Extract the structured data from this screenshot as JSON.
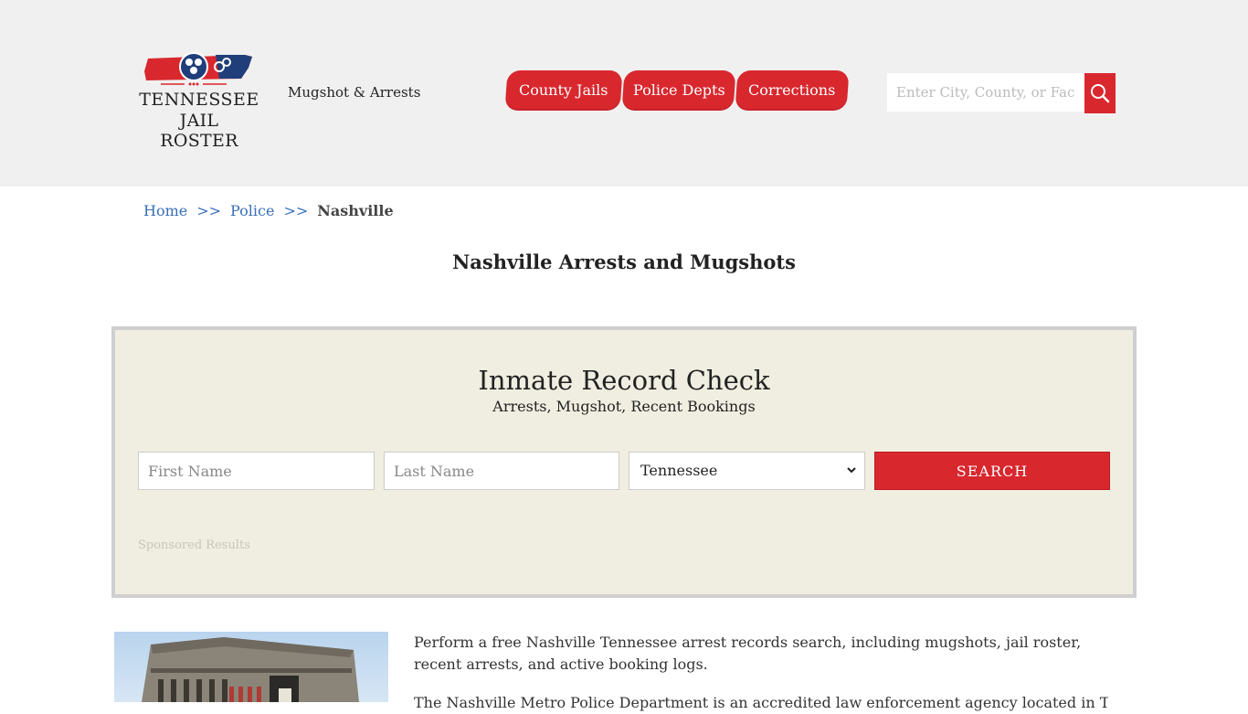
{
  "header": {
    "logo_line1": "TENNESSEE",
    "logo_line2": "JAIL ROSTER",
    "tagline": "Mugshot & Arrests",
    "nav": [
      {
        "label": "County Jails"
      },
      {
        "label": "Police Depts"
      },
      {
        "label": "Corrections"
      }
    ],
    "search": {
      "placeholder": "Enter City, County, or Facility",
      "icon": "magnifier-icon"
    }
  },
  "breadcrumb": {
    "home": "Home",
    "sep": ">>",
    "police": "Police",
    "current": "Nashville"
  },
  "page_title": "Nashville Arrests and Mugshots",
  "record_check": {
    "title": "Inmate Record Check",
    "subtitle": "Arrests, Mugshot, Recent Bookings",
    "first_name_placeholder": "First Name",
    "last_name_placeholder": "Last Name",
    "state_selected": "Tennessee",
    "search_label": "SEARCH",
    "sponsored": "Sponsored Results"
  },
  "content": {
    "intro": "Perform a free Nashville Tennessee arrest records search, including mugshots, jail roster, recent arrests, and active booking logs.",
    "intro2": "The Nashville Metro Police Department is an accredited law enforcement agency located in Tennessee"
  },
  "colors": {
    "accent": "#d9272e",
    "header_bg": "#f0f0f0",
    "panel_bg": "#f0eee0",
    "link": "#3a6fb8"
  }
}
